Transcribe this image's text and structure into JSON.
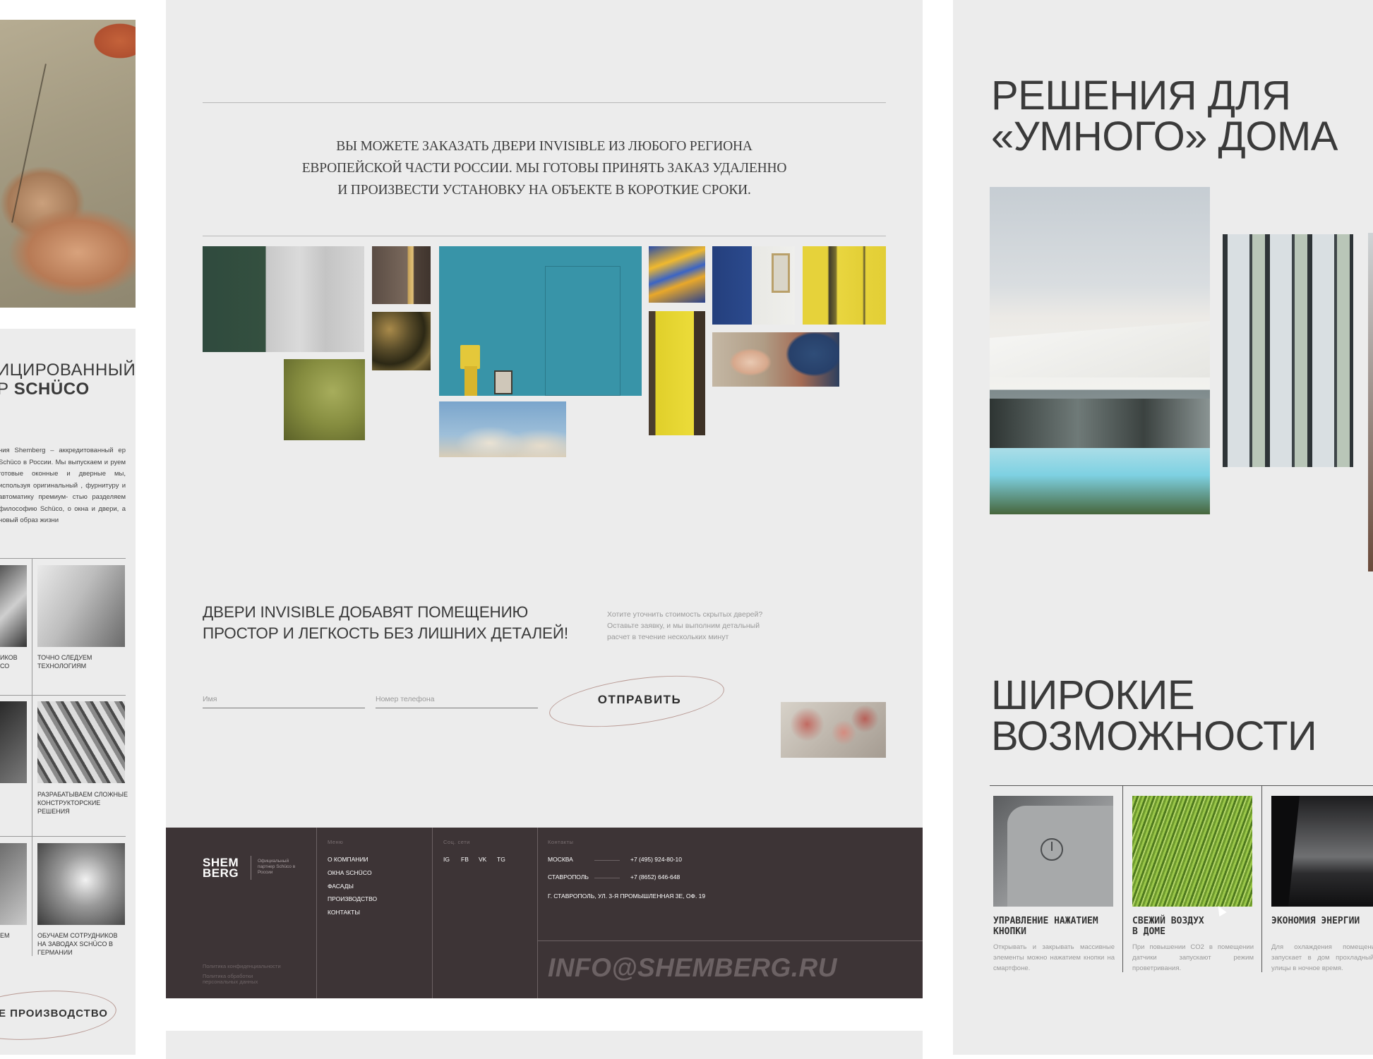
{
  "left_panel": {
    "partner_title_line1": "ИЦИРОВАННЫЙ",
    "partner_title_prefix": "Р ",
    "partner_title_brand": "SCHÜCO",
    "partner_text": "ния Shemberg – аккредитованный ер Schüco в России. Мы выпускаем и руем готовые оконные и дверные мы, используя оригинальный , фурнитуру и автоматику премиум- стью разделяем философию Schüco, о окна и двери, а новый образ жизни",
    "tiles": [
      {
        "left_caption": "ИКОВ СО",
        "right_caption": "ТОЧНО СЛЕДУЕМ ТЕХНОЛОГИЯМ"
      },
      {
        "left_caption": "",
        "right_caption": "РАЗРАБАТЫВАЕМ СЛОЖНЫЕ КОНСТРУКТОРСКИЕ РЕШЕНИЯ"
      },
      {
        "left_caption": "ЕМ",
        "right_caption": "ОБУЧАЕМ СОТРУДНИКОВ НА ЗАВОДАХ SCHÜCO В ГЕРМАНИИ"
      }
    ],
    "production_button": "Е ПРОИЗВОДСТВО"
  },
  "center_panel": {
    "intro_line1": "ВЫ МОЖЕТЕ ЗАКАЗАТЬ ДВЕРИ INVISIBLE ИЗ ЛЮБОГО РЕГИОНА",
    "intro_line2": "ЕВРОПЕЙСКОЙ ЧАСТИ РОССИИ. МЫ ГОТОВЫ ПРИНЯТЬ ЗАКАЗ УДАЛЕННО",
    "intro_line3": "И ПРОИЗВЕСТИ УСТАНОВКУ НА ОБЪЕКТЕ В КОРОТКИЕ СРОКИ.",
    "tagline_line1": "ДВЕРИ INVISIBLE ДОБАВЯТ ПОМЕЩЕНИЮ",
    "tagline_line2": "ПРОСТОР И ЛЕГКОСТЬ  БЕЗ ЛИШНИХ ДЕТАЛЕЙ!",
    "hint_text": "Хотите уточнить стоимость скрытых дверей? Оставьте заявку, и мы выполним детальный расчет в течение нескольких минут",
    "form": {
      "name_placeholder": "Имя",
      "phone_placeholder": "Номер телефона",
      "submit_label": "ОТПРАВИТЬ"
    },
    "accent_color": "#b99a94"
  },
  "footer": {
    "logo_line1": "SHEM",
    "logo_line2": "BERG",
    "logo_note": "Официальный партнер Schüco в России",
    "menu_heading": "Меню",
    "menu_items": [
      "О КОМПАНИИ",
      "ОКНА SCHÜCO",
      "ФАСАДЫ",
      "ПРОИЗВОДСТВО",
      "КОНТАКТЫ"
    ],
    "social_heading": "Соц. сети",
    "social": [
      "IG",
      "FB",
      "VK",
      "TG"
    ],
    "contacts_heading": "Контакты",
    "contacts": [
      {
        "city": "МОСКВА",
        "phone": "+7 (495) 924-80-10"
      },
      {
        "city": "СТАВРОПОЛЬ",
        "phone": "+7 (8652) 646-648"
      }
    ],
    "address": "Г. СТАВРОПОЛЬ, УЛ. 3-Я ПРОМЫШЛЕННАЯ 3Е, ОФ. 19",
    "privacy_policy": "Политика конфиденциальности",
    "data_policy": "Политика обработки персональных данных",
    "email": "INFO@SHEMBERG.RU",
    "background_color": "#3d3436"
  },
  "right_panel": {
    "smart_home_line1": "РЕШЕНИЯ ДЛЯ",
    "smart_home_line2": "«УМНОГО» ДОМА",
    "features_line1": "ШИРОКИЕ",
    "features_line2": "ВОЗМОЖНОСТИ",
    "features": [
      {
        "title_line1": "УПРАВЛЕНИЕ НАЖАТИЕМ",
        "title_line2": "КНОПКИ",
        "text": "Открывать и закрывать массивные элементы можно нажатием кнопки на смартфоне."
      },
      {
        "title_line1": "СВЕЖИЙ ВОЗДУХ",
        "title_line2": "В ДОМЕ",
        "text": "При повышении CO2 в помещении датчики запускают режим проветривания."
      },
      {
        "title_line1": "ЭКОНОМИЯ ЭНЕРГИИ",
        "title_line2": "",
        "text": "Для охлаждения помещения с запускает в дом прохладный в с улицы в ночное время."
      }
    ]
  }
}
